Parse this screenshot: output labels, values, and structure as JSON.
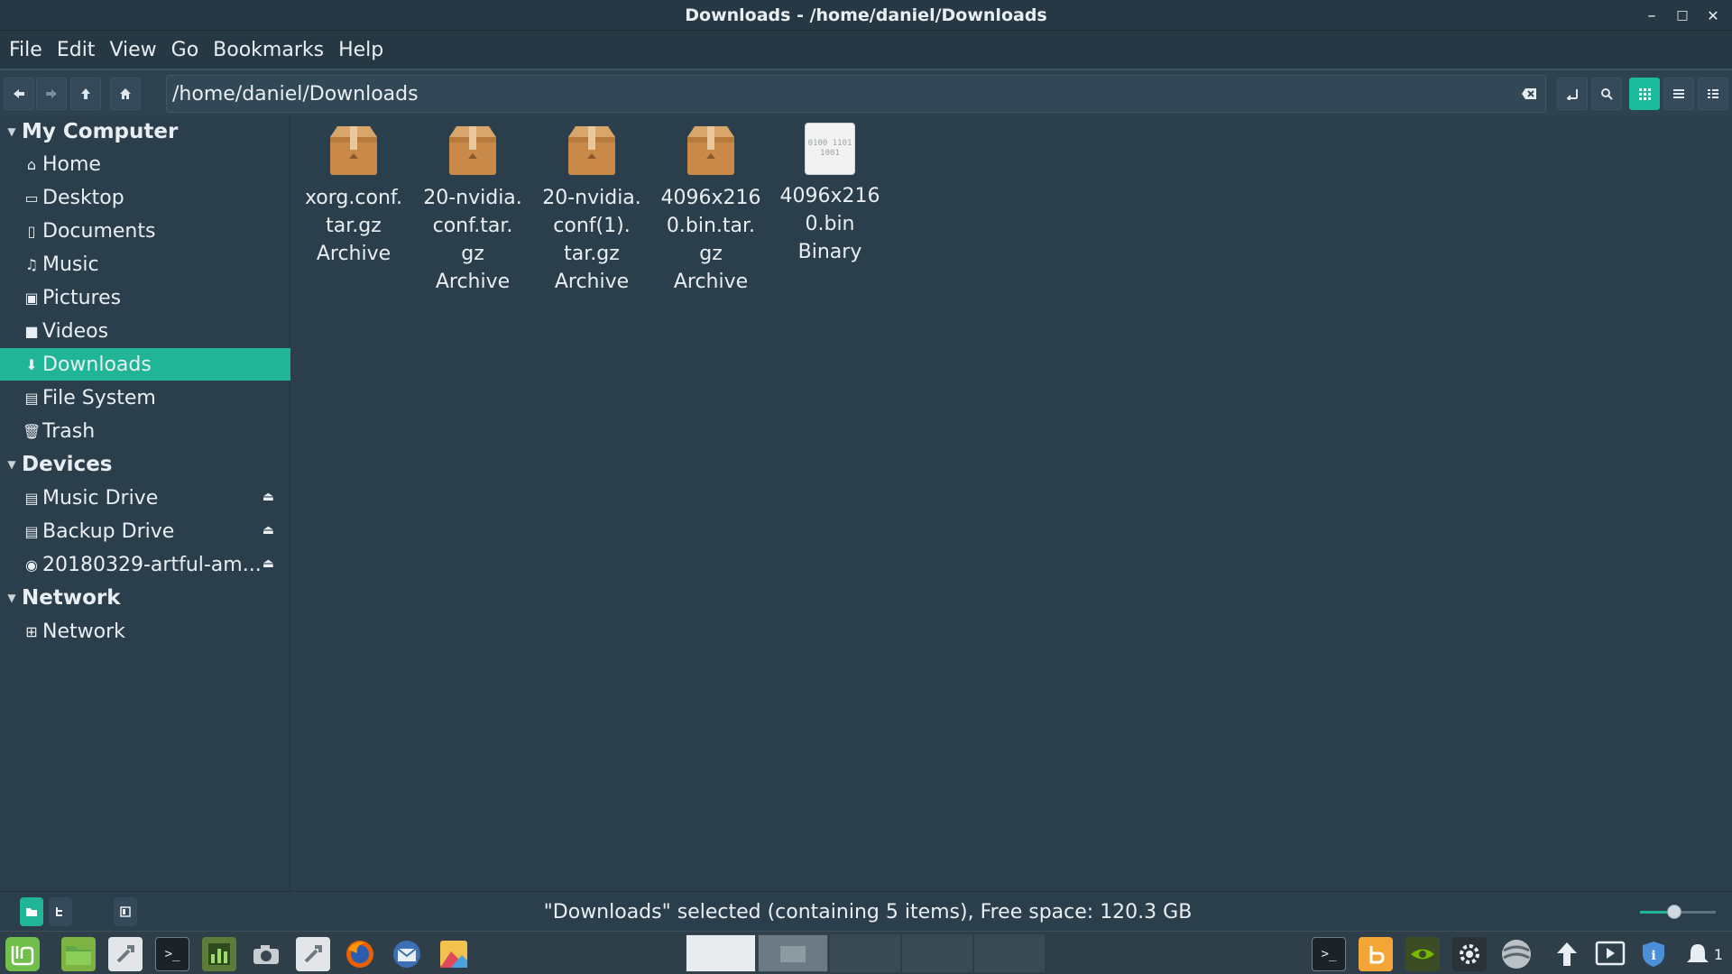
{
  "window": {
    "title": "Downloads - /home/daniel/Downloads",
    "minimize_glyph": "–",
    "maximize_glyph": "□",
    "close_glyph": "✕"
  },
  "menu": [
    "File",
    "Edit",
    "View",
    "Go",
    "Bookmarks",
    "Help"
  ],
  "toolbar": {
    "location": "/home/daniel/Downloads"
  },
  "sidebar": {
    "sections": [
      {
        "title": "My Computer",
        "items": [
          {
            "label": "Home",
            "icon": "home-icon"
          },
          {
            "label": "Desktop",
            "icon": "desktop-icon"
          },
          {
            "label": "Documents",
            "icon": "documents-icon"
          },
          {
            "label": "Music",
            "icon": "music-icon"
          },
          {
            "label": "Pictures",
            "icon": "pictures-icon"
          },
          {
            "label": "Videos",
            "icon": "videos-icon"
          },
          {
            "label": "Downloads",
            "icon": "downloads-icon",
            "selected": true
          },
          {
            "label": "File System",
            "icon": "drive-icon"
          },
          {
            "label": "Trash",
            "icon": "trash-icon"
          }
        ]
      },
      {
        "title": "Devices",
        "items": [
          {
            "label": "Music Drive",
            "icon": "drive-icon",
            "eject": true
          },
          {
            "label": "Backup Drive",
            "icon": "drive-icon",
            "eject": true
          },
          {
            "label": "20180329-artful-am...",
            "icon": "disc-icon",
            "eject": true
          }
        ]
      },
      {
        "title": "Network",
        "items": [
          {
            "label": "Network",
            "icon": "network-icon"
          }
        ]
      }
    ]
  },
  "files": [
    {
      "name_lines": [
        "xorg.conf.",
        "tar.gz"
      ],
      "type": "Archive",
      "icon": "archive-icon"
    },
    {
      "name_lines": [
        "20-nvidia.",
        "conf.tar.",
        "gz"
      ],
      "type": "Archive",
      "icon": "archive-icon"
    },
    {
      "name_lines": [
        "20-nvidia.",
        "conf(1).",
        "tar.gz"
      ],
      "type": "Archive",
      "icon": "archive-icon"
    },
    {
      "name_lines": [
        "4096x216",
        "0.bin.tar.",
        "gz"
      ],
      "type": "Archive",
      "icon": "archive-icon"
    },
    {
      "name_lines": [
        "4096x216",
        "0.bin"
      ],
      "type": "Binary",
      "icon": "binary-icon",
      "icon_text": "0100 1101 1001"
    }
  ],
  "status": {
    "text": "\"Downloads\" selected (containing 5 items), Free space: 120.3 GB",
    "zoom_fraction": 0.45
  },
  "colors": {
    "accent": "#1fb596",
    "background": "#2b3e4c"
  },
  "taskbar": {
    "tray_badge": "1"
  }
}
